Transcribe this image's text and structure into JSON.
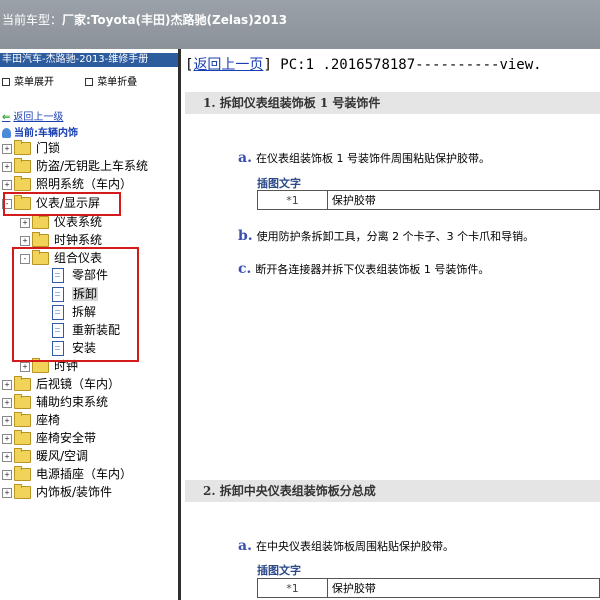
{
  "header": {
    "label": "当前车型：",
    "model": "厂家:Toyota(丰田)杰路驰(Zelas)2013"
  },
  "sidebar": {
    "manual_title": "丰田汽车-杰路驰-2013-维修手册",
    "expand_label": "菜单展开",
    "collapse_label": "菜单折叠",
    "back_label": "返回上一级",
    "current_label": "当前:车辆内饰",
    "tree": [
      {
        "label": "门锁",
        "toggle": "+"
      },
      {
        "label": "防盗/无钥匙上车系统",
        "toggle": "+"
      },
      {
        "label": "照明系统（车内）",
        "toggle": "+"
      },
      {
        "label": "仪表/显示屏",
        "toggle": "-"
      },
      {
        "label": "仪表系统",
        "toggle": "+"
      },
      {
        "label": "时钟系统",
        "toggle": "+"
      },
      {
        "label": "组合仪表",
        "toggle": "-"
      },
      {
        "label": "零部件"
      },
      {
        "label": "拆卸"
      },
      {
        "label": "拆解"
      },
      {
        "label": "重新装配"
      },
      {
        "label": "安装"
      },
      {
        "label": "时钟",
        "toggle": "+"
      },
      {
        "label": "后视镜（车内）",
        "toggle": "+"
      },
      {
        "label": "辅助约束系统",
        "toggle": "+"
      },
      {
        "label": "座椅",
        "toggle": "+"
      },
      {
        "label": "座椅安全带",
        "toggle": "+"
      },
      {
        "label": "暖风/空调",
        "toggle": "+"
      },
      {
        "label": "电源插座（车内）",
        "toggle": "+"
      },
      {
        "label": "内饰板/装饰件",
        "toggle": "+"
      }
    ]
  },
  "content": {
    "back_link": "返回上一页",
    "bracket_open": "[",
    "bracket_close": "]",
    "page_code": " PC:1 .2016578187----------view.",
    "section1": {
      "title": "1. 拆卸仪表组装饰板 1 号装饰件",
      "steps": [
        {
          "letter": "a.",
          "text": "在仪表组装饰板 1 号装饰件周围粘贴保护胶带。"
        },
        {
          "letter": "b.",
          "text": "使用防护条拆卸工具，分离 2 个卡子、3 个卡爪和导销。"
        },
        {
          "letter": "c.",
          "text": "断开各连接器并拆下仪表组装饰板 1 号装饰件。"
        }
      ],
      "figure_label": "插图文字",
      "figure_num": "*1",
      "figure_text": "保护胶带"
    },
    "section2": {
      "title": "2. 拆卸中央仪表组装饰板分总成",
      "steps": [
        {
          "letter": "a.",
          "text": "在中央仪表组装饰板周围粘贴保护胶带。"
        }
      ],
      "figure_label": "插图文字",
      "figure_num": "*1",
      "figure_text": "保护胶带"
    }
  },
  "colors": {
    "header_bg": "#8b9299",
    "manual_title_bg": "#2c5b9e",
    "highlight_border": "#d41a1a",
    "link": "#1a3fb3"
  }
}
